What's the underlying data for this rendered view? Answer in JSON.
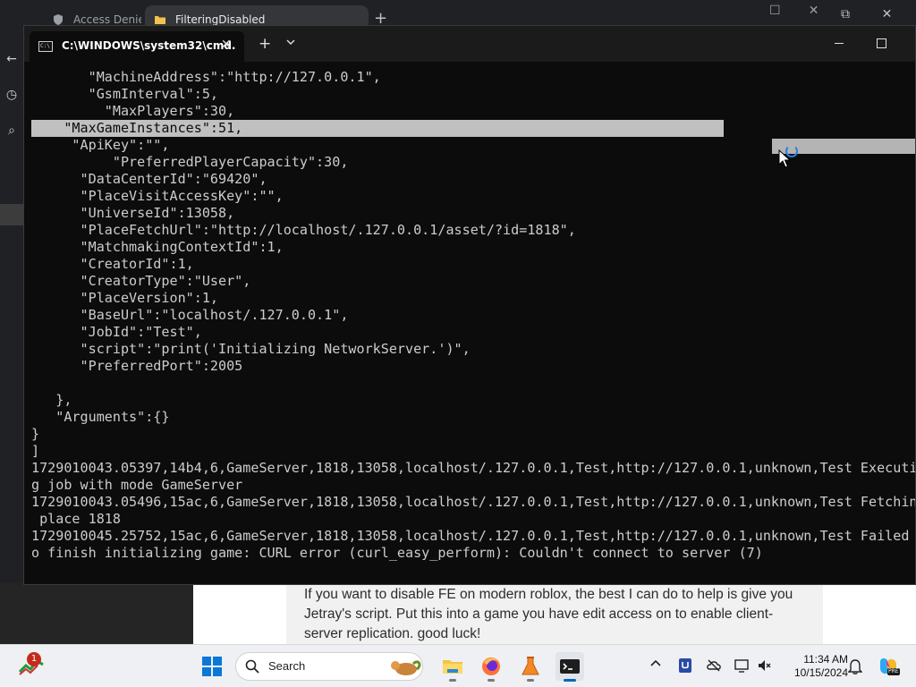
{
  "browser": {
    "tabs": [
      {
        "label": "Access Denied"
      },
      {
        "label": "FilteringDisabled"
      }
    ],
    "post_text": "If you want to disable FE on modern roblox, the best I can do to help is give you Jetray's script. Put this into a game you have edit access on to enable client-server replication. good luck!"
  },
  "terminal": {
    "tab_title": "C:\\WINDOWS\\system32\\cmd.",
    "icon_text": "C:\\",
    "lines": [
      "       \"MachineAddress\":\"http://127.0.0.1\",",
      "       \"GsmInterval\":5,",
      "         \"MaxPlayers\":30,",
      "",
      "     \"ApiKey\":\"\",",
      "          \"PreferredPlayerCapacity\":30,",
      "      \"DataCenterId\":\"69420\",",
      "      \"PlaceVisitAccessKey\":\"\",",
      "      \"UniverseId\":13058,",
      "      \"PlaceFetchUrl\":\"http://localhost/.127.0.0.1/asset/?id=1818\",",
      "      \"MatchmakingContextId\":1,",
      "      \"CreatorId\":1,",
      "      \"CreatorType\":\"User\",",
      "      \"PlaceVersion\":1,",
      "      \"BaseUrl\":\"localhost/.127.0.0.1\",",
      "      \"JobId\":\"Test\",",
      "      \"script\":\"print('Initializing NetworkServer.')\",",
      "      \"PreferredPort\":2005",
      "",
      "   },",
      "   \"Arguments\":{}",
      "}",
      "]",
      "1729010043.05397,14b4,6,GameServer,1818,13058,localhost/.127.0.0.1,Test,http://127.0.0.1,unknown,Test Executin",
      "g job with mode GameServer",
      "1729010043.05496,15ac,6,GameServer,1818,13058,localhost/.127.0.0.1,Test,http://127.0.0.1,unknown,Test Fetching",
      " place 1818",
      "1729010045.25752,15ac,6,GameServer,1818,13058,localhost/.127.0.0.1,Test,http://127.0.0.1,unknown,Test Failed t",
      "o finish initializing game: CURL error (curl_easy_perform): Couldn't connect to server (7)"
    ],
    "selected_line": "    \"MaxGameInstances\":51,"
  },
  "taskbar": {
    "widget_badge": "1",
    "search_label": "Search",
    "clock_time": "11:34 AM",
    "clock_date": "10/15/2024",
    "copilot_badge": "PRE"
  },
  "colors": {
    "terminal_bg": "#0c0c0c",
    "terminal_text": "#cccccc",
    "selection": "#c0c0c0",
    "accent": "#0067c0"
  }
}
